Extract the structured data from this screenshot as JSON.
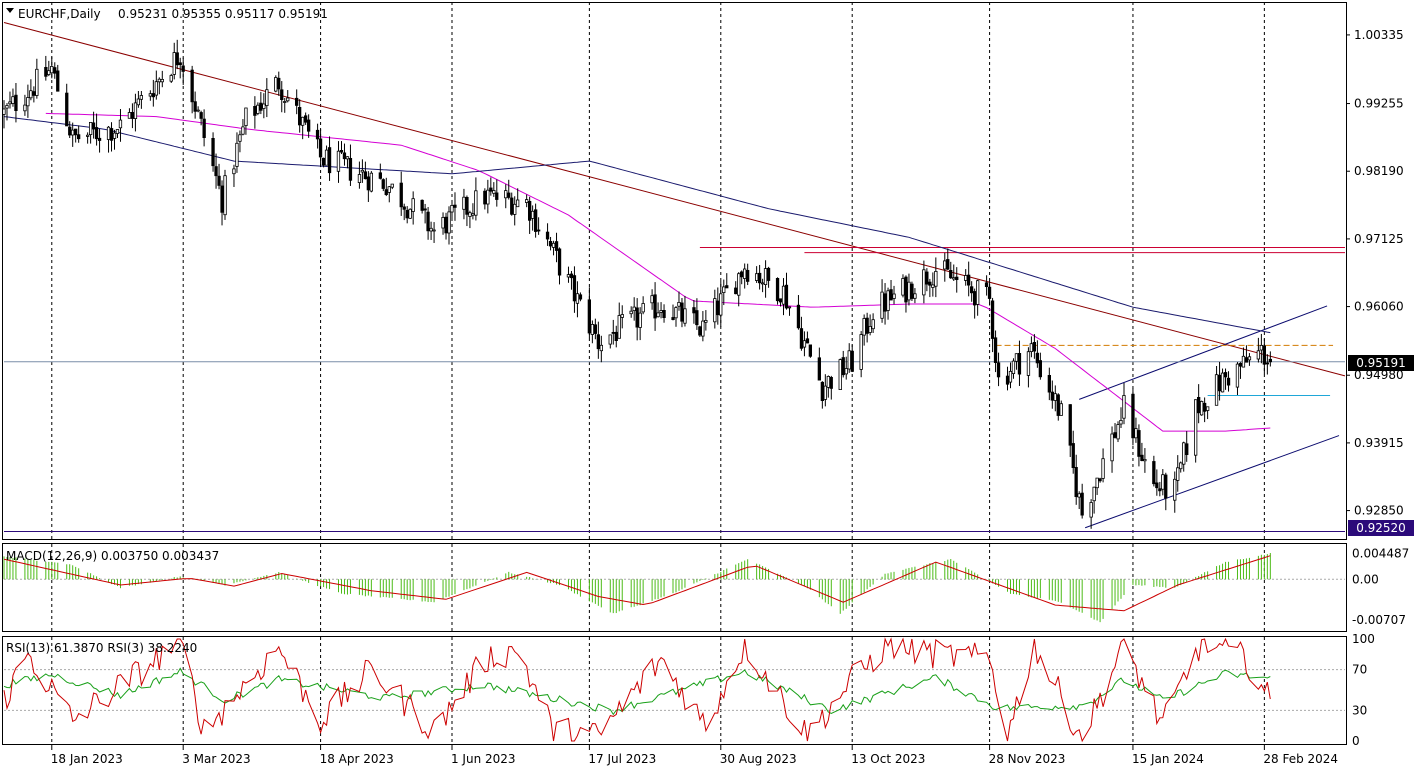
{
  "colors": {
    "background": "#ffffff",
    "candle_up": "#ffffff",
    "candle_down": "#000000",
    "ma_fast": "#d400d4",
    "ma_slow": "#1a1a6e",
    "trendline_main": "#8b0000",
    "channel_lines": "#0a0a6e",
    "resistance": "#cc0033",
    "support_line": "#2b0a7a",
    "fib_line": "#d27b00",
    "cyan_line": "#1fa7d8",
    "current_price": "#7a8ea8",
    "macd_hist": "#4cbb17",
    "macd_signal": "#cc0000",
    "rsi_fast": "#cc0000",
    "rsi_slow": "#19a019"
  },
  "header": {
    "arrow_icon": "triangle-down",
    "symbol_timeframe": "EURCHF,Daily",
    "ohlc": "0.95231 0.95355 0.95117 0.95191"
  },
  "price_axis": {
    "ticks": [
      "1.00335",
      "0.99255",
      "0.98190",
      "0.97125",
      "0.96060",
      "0.94980",
      "0.93915",
      "0.92850"
    ],
    "current_price_tag": "0.95191",
    "support_tag": "0.92520"
  },
  "macd": {
    "label": "MACD(12,26,9) 0.003750 0.003437",
    "ticks": [
      "0.004487",
      "0.00",
      "-0.00707"
    ]
  },
  "rsi": {
    "label": "RSI(13) 61.3870 RSI(3) 38.2240",
    "ticks": [
      "100",
      "70",
      "30",
      "0"
    ]
  },
  "time_axis": {
    "labels": [
      "18 Jan 2023",
      "3 Mar 2023",
      "18 Apr 2023",
      "1 Jun 2023",
      "17 Jul 2023",
      "30 Aug 2023",
      "13 Oct 2023",
      "28 Nov 2023",
      "15 Jan 2024",
      "28 Feb 2024"
    ]
  },
  "chart_data": {
    "type": "candlestick",
    "symbol": "EURCHF",
    "timeframe": "Daily",
    "ylim": [
      0.9245,
      1.0079
    ],
    "x_range": [
      "2023-01-02",
      "2024-03-26"
    ],
    "price_series_keypoints": [
      {
        "date": "2023-01-02",
        "close": 0.991
      },
      {
        "date": "2023-01-18",
        "close": 0.998
      },
      {
        "date": "2023-01-25",
        "close": 0.987
      },
      {
        "date": "2023-02-10",
        "close": 0.989
      },
      {
        "date": "2023-03-02",
        "close": 1.0005
      },
      {
        "date": "2023-03-16",
        "close": 0.9775
      },
      {
        "date": "2023-03-24",
        "close": 0.99
      },
      {
        "date": "2023-04-04",
        "close": 0.996
      },
      {
        "date": "2023-04-18",
        "close": 0.984
      },
      {
        "date": "2023-05-10",
        "close": 0.98
      },
      {
        "date": "2023-05-26",
        "close": 0.9725
      },
      {
        "date": "2023-06-12",
        "close": 0.978
      },
      {
        "date": "2023-06-26",
        "close": 0.977
      },
      {
        "date": "2023-07-05",
        "close": 0.969
      },
      {
        "date": "2023-07-20",
        "close": 0.955
      },
      {
        "date": "2023-08-10",
        "close": 0.961
      },
      {
        "date": "2023-08-24",
        "close": 0.957
      },
      {
        "date": "2023-09-07",
        "close": 0.967
      },
      {
        "date": "2023-09-20",
        "close": 0.963
      },
      {
        "date": "2023-10-03",
        "close": 0.948
      },
      {
        "date": "2023-10-13",
        "close": 0.952
      },
      {
        "date": "2023-10-20",
        "close": 0.96
      },
      {
        "date": "2023-11-10",
        "close": 0.9665
      },
      {
        "date": "2023-11-28",
        "close": 0.9615
      },
      {
        "date": "2023-12-01",
        "close": 0.949
      },
      {
        "date": "2023-12-12",
        "close": 0.954
      },
      {
        "date": "2023-12-22",
        "close": 0.9435
      },
      {
        "date": "2023-12-29",
        "close": 0.928
      },
      {
        "date": "2024-01-12",
        "close": 0.9445
      },
      {
        "date": "2024-01-22",
        "close": 0.9325
      },
      {
        "date": "2024-01-29",
        "close": 0.9315
      },
      {
        "date": "2024-02-05",
        "close": 0.9445
      },
      {
        "date": "2024-02-14",
        "close": 0.949
      },
      {
        "date": "2024-02-27",
        "close": 0.9535
      },
      {
        "date": "2024-03-01",
        "close": 0.95191
      }
    ],
    "last_bar": {
      "open": 0.95231,
      "high": 0.95355,
      "low": 0.95117,
      "close": 0.95191
    },
    "moving_averages": [
      {
        "role": "fast",
        "color": "#d400d4",
        "points": [
          {
            "date": "2023-01-16",
            "value": 0.991
          },
          {
            "date": "2023-02-22",
            "value": 0.9905
          },
          {
            "date": "2023-03-25",
            "value": 0.9885
          },
          {
            "date": "2023-05-15",
            "value": 0.986
          },
          {
            "date": "2023-06-10",
            "value": 0.982
          },
          {
            "date": "2023-07-10",
            "value": 0.975
          },
          {
            "date": "2023-08-20",
            "value": 0.9615
          },
          {
            "date": "2023-09-30",
            "value": 0.9605
          },
          {
            "date": "2023-11-01",
            "value": 0.961
          },
          {
            "date": "2023-11-25",
            "value": 0.961
          },
          {
            "date": "2023-12-20",
            "value": 0.954
          },
          {
            "date": "2024-01-25",
            "value": 0.941
          },
          {
            "date": "2024-02-15",
            "value": 0.941
          },
          {
            "date": "2024-03-01",
            "value": 0.9415
          }
        ]
      },
      {
        "role": "slow",
        "color": "#1a1a6e",
        "points": [
          {
            "date": "2023-01-02",
            "value": 0.9905
          },
          {
            "date": "2023-02-05",
            "value": 0.9885
          },
          {
            "date": "2023-03-20",
            "value": 0.9835
          },
          {
            "date": "2023-06-01",
            "value": 0.9815
          },
          {
            "date": "2023-07-17",
            "value": 0.9835
          },
          {
            "date": "2023-09-15",
            "value": 0.976
          },
          {
            "date": "2023-11-01",
            "value": 0.9715
          },
          {
            "date": "2024-01-15",
            "value": 0.9605
          },
          {
            "date": "2024-03-01",
            "value": 0.9565
          }
        ]
      }
    ],
    "annotations": [
      {
        "type": "trendline",
        "from": {
          "date": "2023-01-02",
          "value": 1.0053
        },
        "to": {
          "date": "2024-03-26",
          "value": 0.9497
        }
      },
      {
        "type": "channel-upper",
        "from": {
          "date": "2023-12-28",
          "value": 0.946
        },
        "to": {
          "date": "2024-03-20",
          "value": 0.9607
        }
      },
      {
        "type": "channel-lower",
        "from": {
          "date": "2023-12-30",
          "value": 0.9258
        },
        "to": {
          "date": "2024-03-24",
          "value": 0.9403
        }
      },
      {
        "type": "horizontal",
        "value": 0.9699,
        "from": "2023-08-23",
        "to": "2024-03-26"
      },
      {
        "type": "horizontal",
        "value": 0.9691,
        "from": "2023-09-27",
        "to": "2024-03-26"
      },
      {
        "type": "horizontal-dashed",
        "value": 0.9545,
        "from": "2023-11-30",
        "to": "2024-03-22"
      },
      {
        "type": "horizontal",
        "value": 0.9466,
        "from": "2024-02-09",
        "to": "2024-03-21"
      },
      {
        "type": "horizontal",
        "value": 0.9252,
        "from": "2023-01-02",
        "to": "2024-03-26"
      }
    ],
    "macd": {
      "fast": 12,
      "slow": 26,
      "signal": 9,
      "main": 0.00375,
      "signal_value": 0.003437,
      "ylim": [
        -0.0085,
        0.0058
      ],
      "histogram_keypoints": [
        {
          "date": "2023-01-02",
          "value": 0.004
        },
        {
          "date": "2023-01-25",
          "value": 0.0025
        },
        {
          "date": "2023-02-10",
          "value": -0.0015
        },
        {
          "date": "2023-03-02",
          "value": 0.0005
        },
        {
          "date": "2023-03-17",
          "value": -0.001
        },
        {
          "date": "2023-04-04",
          "value": 0.0012
        },
        {
          "date": "2023-04-25",
          "value": -0.0025
        },
        {
          "date": "2023-05-26",
          "value": -0.004
        },
        {
          "date": "2023-06-20",
          "value": 0.0012
        },
        {
          "date": "2023-07-07",
          "value": -0.001
        },
        {
          "date": "2023-07-25",
          "value": -0.006
        },
        {
          "date": "2023-08-14",
          "value": -0.0025
        },
        {
          "date": "2023-09-08",
          "value": 0.0035
        },
        {
          "date": "2023-09-28",
          "value": -0.0015
        },
        {
          "date": "2023-10-09",
          "value": -0.006
        },
        {
          "date": "2023-10-24",
          "value": 0.001
        },
        {
          "date": "2023-11-15",
          "value": 0.0035
        },
        {
          "date": "2023-12-05",
          "value": -0.0025
        },
        {
          "date": "2023-12-22",
          "value": -0.004
        },
        {
          "date": "2024-01-04",
          "value": -0.0075
        },
        {
          "date": "2024-01-15",
          "value": -0.001
        },
        {
          "date": "2024-01-29",
          "value": -0.0015
        },
        {
          "date": "2024-02-15",
          "value": 0.003
        },
        {
          "date": "2024-03-01",
          "value": 0.0045
        }
      ],
      "signal_keypoints": [
        {
          "date": "2023-01-02",
          "value": 0.0035
        },
        {
          "date": "2023-02-10",
          "value": -0.001
        },
        {
          "date": "2023-03-05",
          "value": 0.0002
        },
        {
          "date": "2023-03-20",
          "value": -0.0012
        },
        {
          "date": "2023-04-05",
          "value": 0.001
        },
        {
          "date": "2023-05-05",
          "value": -0.002
        },
        {
          "date": "2023-05-30",
          "value": -0.0035
        },
        {
          "date": "2023-06-26",
          "value": 0.0012
        },
        {
          "date": "2023-07-20",
          "value": -0.003
        },
        {
          "date": "2023-08-05",
          "value": -0.0045
        },
        {
          "date": "2023-09-10",
          "value": 0.0025
        },
        {
          "date": "2023-10-10",
          "value": -0.004
        },
        {
          "date": "2023-11-10",
          "value": 0.003
        },
        {
          "date": "2023-12-20",
          "value": -0.0045
        },
        {
          "date": "2024-01-12",
          "value": -0.0055
        },
        {
          "date": "2024-01-30",
          "value": -0.001
        },
        {
          "date": "2024-03-01",
          "value": 0.0041
        }
      ]
    },
    "rsi": {
      "periods": [
        13,
        3
      ],
      "values": {
        "rsi13": 61.387,
        "rsi3": 38.224
      },
      "ylim": [
        0,
        100
      ],
      "levels": [
        30,
        70
      ],
      "rsi13_keypoints": [
        {
          "date": "2023-01-02",
          "value": 55
        },
        {
          "date": "2023-01-18",
          "value": 65
        },
        {
          "date": "2023-02-10",
          "value": 45
        },
        {
          "date": "2023-03-02",
          "value": 68
        },
        {
          "date": "2023-03-17",
          "value": 40
        },
        {
          "date": "2023-04-04",
          "value": 60
        },
        {
          "date": "2023-05-10",
          "value": 42
        },
        {
          "date": "2023-06-12",
          "value": 55
        },
        {
          "date": "2023-07-25",
          "value": 30
        },
        {
          "date": "2023-09-07",
          "value": 68
        },
        {
          "date": "2023-10-06",
          "value": 30
        },
        {
          "date": "2023-11-10",
          "value": 62
        },
        {
          "date": "2023-12-01",
          "value": 32
        },
        {
          "date": "2023-12-30",
          "value": 35
        },
        {
          "date": "2024-01-12",
          "value": 60
        },
        {
          "date": "2024-01-25",
          "value": 40
        },
        {
          "date": "2024-02-15",
          "value": 66
        },
        {
          "date": "2024-03-01",
          "value": 61.387
        }
      ],
      "rsi3_keypoints": [
        {
          "date": "2023-01-02",
          "value": 40
        },
        {
          "date": "2023-01-10",
          "value": 85
        },
        {
          "date": "2023-01-25",
          "value": 20
        },
        {
          "date": "2023-02-22",
          "value": 80
        },
        {
          "date": "2023-03-02",
          "value": 98
        },
        {
          "date": "2023-03-10",
          "value": 10
        },
        {
          "date": "2023-04-04",
          "value": 92
        },
        {
          "date": "2023-04-18",
          "value": 20
        },
        {
          "date": "2023-05-05",
          "value": 70
        },
        {
          "date": "2023-05-26",
          "value": 10
        },
        {
          "date": "2023-06-12",
          "value": 80
        },
        {
          "date": "2023-06-23",
          "value": 90
        },
        {
          "date": "2023-07-05",
          "value": 10
        },
        {
          "date": "2023-07-20",
          "value": 5
        },
        {
          "date": "2023-08-10",
          "value": 80
        },
        {
          "date": "2023-08-25",
          "value": 15
        },
        {
          "date": "2023-09-07",
          "value": 95
        },
        {
          "date": "2023-09-28",
          "value": 5
        },
        {
          "date": "2023-10-13",
          "value": 60
        },
        {
          "date": "2023-10-25",
          "value": 95
        },
        {
          "date": "2023-11-10",
          "value": 85
        },
        {
          "date": "2023-11-28",
          "value": 80
        },
        {
          "date": "2023-12-04",
          "value": 5
        },
        {
          "date": "2023-12-13",
          "value": 95
        },
        {
          "date": "2023-12-29",
          "value": 2
        },
        {
          "date": "2024-01-12",
          "value": 95
        },
        {
          "date": "2024-01-25",
          "value": 15
        },
        {
          "date": "2024-02-07",
          "value": 98
        },
        {
          "date": "2024-02-22",
          "value": 80
        },
        {
          "date": "2024-03-01",
          "value": 38.224
        }
      ]
    }
  }
}
